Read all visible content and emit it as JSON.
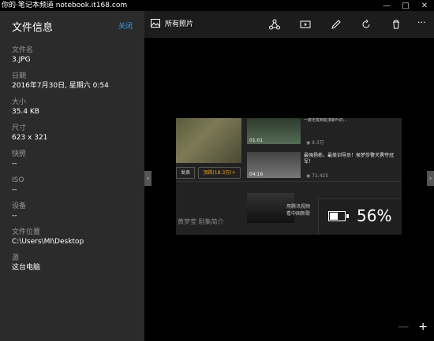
{
  "watermark": "你的·笔记本频道 notebook.it168.com",
  "sidebar": {
    "title": "文件信息",
    "close_label": "关闭",
    "fields": [
      {
        "label": "文件名",
        "value": "3.JPG"
      },
      {
        "label": "日期",
        "value": "2016年7月30日, 星期六 0:54"
      },
      {
        "label": "大小",
        "value": "35.4 KB"
      },
      {
        "label": "尺寸",
        "value": "623 x 321"
      },
      {
        "label": "快照",
        "value": "--"
      },
      {
        "label": "ISO",
        "value": "--"
      },
      {
        "label": "设备",
        "value": "--"
      },
      {
        "label": "文件位置",
        "value": "C:\\Users\\MI\\Desktop"
      },
      {
        "label": "源",
        "value": "这台电脑"
      }
    ]
  },
  "toolbar": {
    "album_label": "所有照片",
    "icons": [
      "share-icon",
      "slideshow-icon",
      "edit-icon",
      "rotate-icon",
      "delete-icon",
      "more-icon"
    ]
  },
  "photo": {
    "video1_time": "01:01",
    "video1_caption": "一群无蒸到蛇滨新叶的...",
    "video1_views": "9.3万",
    "video2_time": "04:16",
    "video2_caption": "最强扬栋，最美训导员！侯梦莎警犬勇夺冠军！",
    "video2_views": "72,425",
    "comment_btn": "发表",
    "like_btn": "顶踩(18.3万)+",
    "bottom_title": "黄梦莹 剧集简介",
    "ad_text1": "用腾讯视频",
    "ad_text2": "看中国新歌",
    "battery_text": "56%",
    "battery_level": 0.56
  },
  "zoom": {
    "minus": "—",
    "plus": "+"
  }
}
